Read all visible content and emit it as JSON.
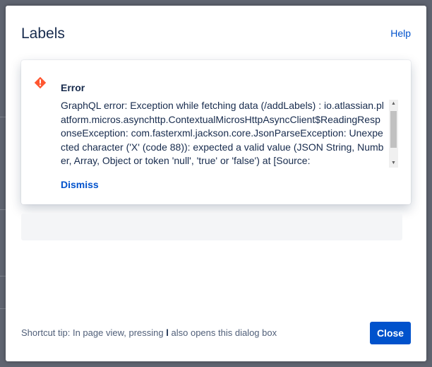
{
  "dialog": {
    "title": "Labels",
    "help_label": "Help"
  },
  "error_flag": {
    "icon": "error-icon",
    "title": "Error",
    "message": "GraphQL error: Exception while fetching data (/addLabels) : io.atlassian.platform.micros.asynchttp.ContextualMicrosHttpAsyncClient$ReadingResponseException: com.fasterxml.jackson.core.JsonParseException: Unexpected character ('X' (code 88)): expected a valid value (JSON String, Number, Array, Object or token 'null', 'true' or 'false') at [Source:",
    "dismiss_label": "Dismiss",
    "icon_color": "#ff5630"
  },
  "footer": {
    "tip_prefix": "Shortcut tip: In page view, pressing",
    "tip_key": "l",
    "tip_suffix": "also opens this dialog box",
    "close_label": "Close"
  },
  "colors": {
    "primary": "#0052cc",
    "text": "#172b4d",
    "overlay": "#5f6470"
  }
}
